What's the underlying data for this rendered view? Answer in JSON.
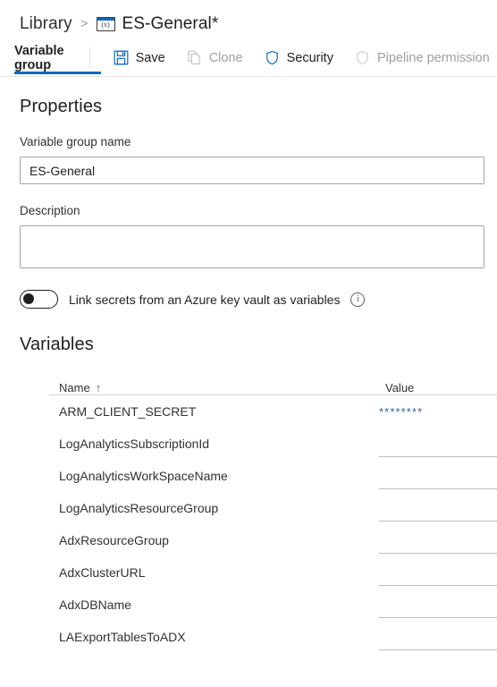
{
  "breadcrumb": {
    "root": "Library",
    "separator": ">",
    "icon": "variable-group-icon",
    "icon_glyph": "(x)",
    "current": "ES-General*"
  },
  "toolbar": {
    "tab_label": "Variable group",
    "save_label": "Save",
    "clone_label": "Clone",
    "security_label": "Security",
    "pipeline_permissions_label": "Pipeline permission",
    "accent_color": "#0f6cbd",
    "disabled_color": "#a19f9d"
  },
  "properties": {
    "heading": "Properties",
    "name_label": "Variable group name",
    "name_value": "ES-General",
    "name_placeholder": "",
    "description_label": "Description",
    "description_value": "",
    "description_placeholder": "",
    "keyvault_toggle_label": "Link secrets from an Azure key vault as variables",
    "keyvault_toggle_state": "off",
    "info_icon": "info-icon",
    "info_glyph": "i"
  },
  "variables": {
    "heading": "Variables",
    "columns": {
      "name": "Name",
      "sort_arrow": "↑",
      "value": "Value"
    },
    "rows": [
      {
        "name": "ARM_CLIENT_SECRET",
        "value": "********",
        "masked": true
      },
      {
        "name": "LogAnalyticsSubscriptionId",
        "value": "",
        "masked": false
      },
      {
        "name": "LogAnalyticsWorkSpaceName",
        "value": "",
        "masked": false
      },
      {
        "name": "LogAnalyticsResourceGroup",
        "value": "",
        "masked": false
      },
      {
        "name": "AdxResourceGroup",
        "value": "",
        "masked": false
      },
      {
        "name": "AdxClusterURL",
        "value": "",
        "masked": false
      },
      {
        "name": "AdxDBName",
        "value": "",
        "masked": false
      },
      {
        "name": "LAExportTablesToADX",
        "value": "",
        "masked": false
      }
    ]
  }
}
